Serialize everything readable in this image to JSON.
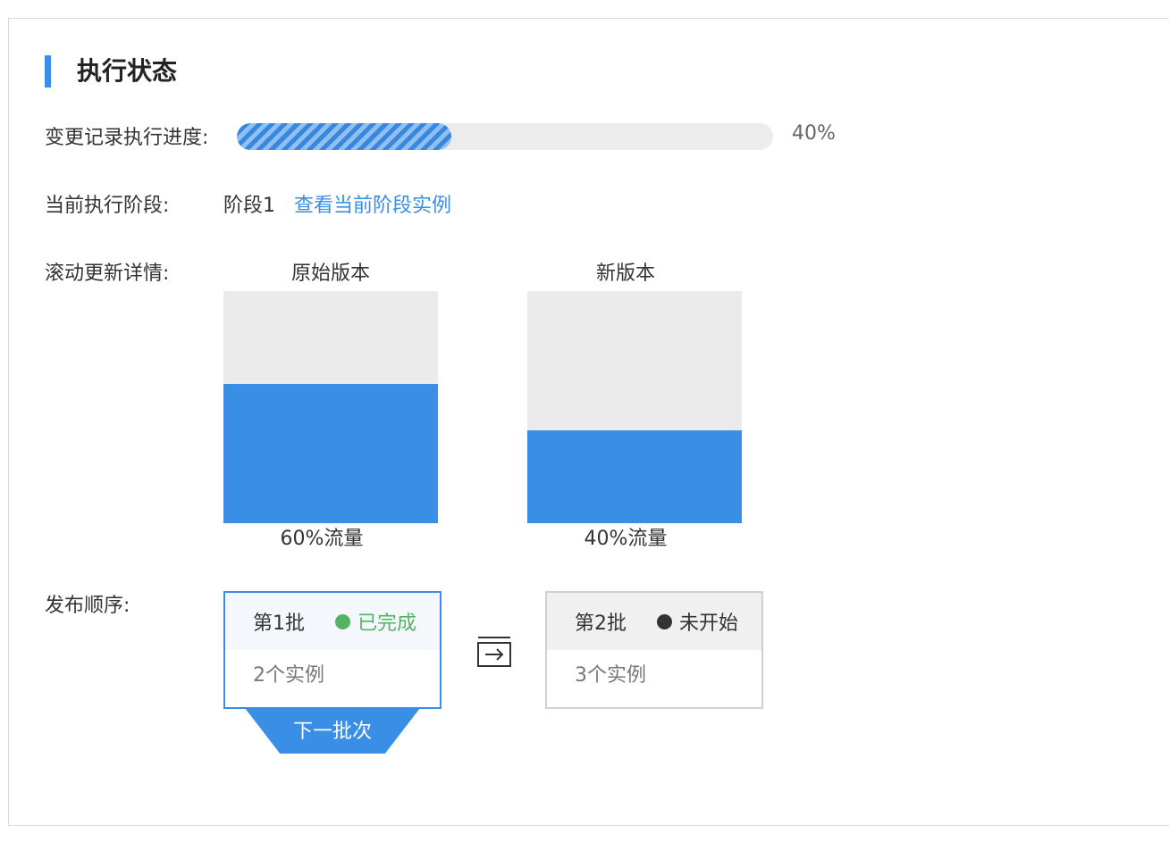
{
  "section": {
    "title": "执行状态"
  },
  "progress": {
    "label": "变更记录执行进度:",
    "percent": 40,
    "percent_text": "40%"
  },
  "stage": {
    "label": "当前执行阶段:",
    "value": "阶段1",
    "link": "查看当前阶段实例"
  },
  "rolling": {
    "label": "滚动更新详情:",
    "columns": [
      {
        "title": "原始版本",
        "traffic_percent": 60,
        "caption": "60%流量"
      },
      {
        "title": "新版本",
        "traffic_percent": 40,
        "caption": "40%流量"
      }
    ]
  },
  "release": {
    "label": "发布顺序:",
    "batches": [
      {
        "name": "第1批",
        "status": "已完成",
        "status_color": "#52b45f",
        "instances": "2个实例"
      },
      {
        "name": "第2批",
        "status": "未开始",
        "status_color": "#333333",
        "instances": "3个实例"
      }
    ],
    "next_button": "下一批次",
    "arrow_icon": "arrow-right-into-box-icon"
  },
  "colors": {
    "accent": "#3a8ee6",
    "track": "#ececec"
  }
}
